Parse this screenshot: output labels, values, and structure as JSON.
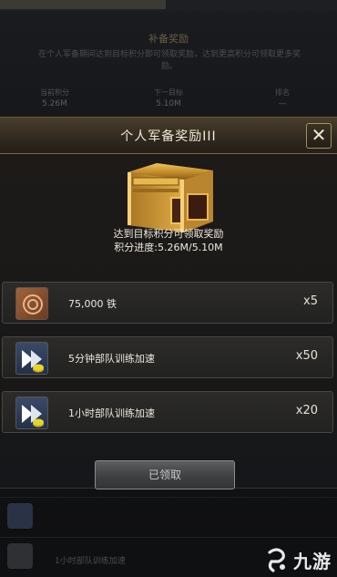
{
  "background": {
    "title": "补备奖励",
    "description": "在个人军备期间达到目标积分即可领取奖励，达到更高积分可领取更多奖励。",
    "columns": [
      {
        "label": "当前积分",
        "value": "5.26M"
      },
      {
        "label": "下一目标",
        "value": "5.10M"
      },
      {
        "label": "排名",
        "value": "—"
      }
    ],
    "lower_rows": [
      {
        "text": ""
      },
      {
        "text": "1小时部队训练加速"
      }
    ]
  },
  "modal": {
    "title": "个人军备奖励III",
    "close_label": "✕",
    "chest_icon": "treasure-chest",
    "info_line1": "达到目标积分可领取奖励",
    "info_line2": "积分进度:5.26M/5.10M",
    "rewards": [
      {
        "icon": "iron-resource-icon",
        "name": "75,000 铁",
        "qty": "x5"
      },
      {
        "icon": "speedup-icon",
        "name": "5分钟部队训练加速",
        "qty": "x50"
      },
      {
        "icon": "speedup-icon",
        "name": "1小时部队训练加速",
        "qty": "x20"
      }
    ],
    "claim_label": "已领取"
  },
  "watermark": {
    "text": "九游"
  },
  "colors": {
    "accent_gold": "#c89a3a",
    "header_bg": "#3a3124",
    "button_gray": "#4a4b4d"
  }
}
